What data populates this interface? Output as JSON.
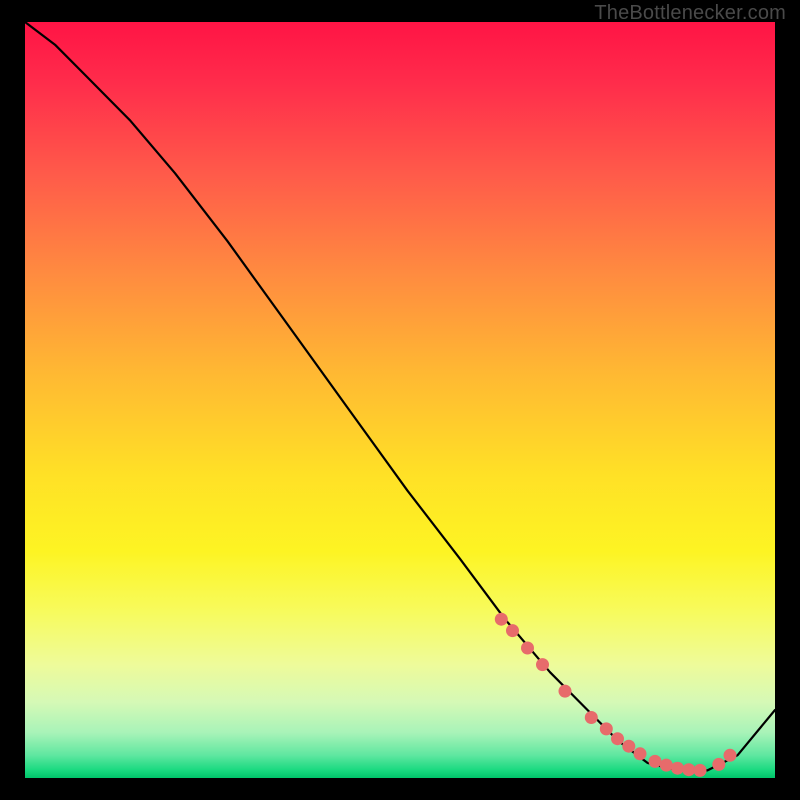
{
  "watermark": "TheBottlenecker.com",
  "chart_data": {
    "type": "line",
    "title": "",
    "xlabel": "",
    "ylabel": "",
    "xlim": [
      0,
      100
    ],
    "ylim": [
      0,
      100
    ],
    "curve": {
      "x": [
        0,
        4,
        8,
        14,
        20,
        27,
        35,
        43,
        51,
        58,
        64,
        70,
        75,
        79,
        83,
        87,
        91,
        95,
        100
      ],
      "y": [
        100,
        97,
        93,
        87,
        80,
        71,
        60,
        49,
        38,
        29,
        21,
        14,
        9,
        5,
        2,
        1,
        1,
        3,
        9
      ]
    },
    "markers": {
      "x": [
        63.5,
        65,
        67,
        69,
        72,
        75.5,
        77.5,
        79,
        80.5,
        82,
        84,
        85.5,
        87,
        88.5,
        90,
        92.5,
        94
      ],
      "y": [
        21,
        19.5,
        17.2,
        15,
        11.5,
        8,
        6.5,
        5.2,
        4.2,
        3.2,
        2.2,
        1.7,
        1.3,
        1.1,
        1,
        1.8,
        3
      ],
      "color": "#e76b6b",
      "radius": 6.5
    },
    "gradient_stops": [
      {
        "pos": 0.0,
        "color": "#ff1445"
      },
      {
        "pos": 0.2,
        "color": "#ff5a4a"
      },
      {
        "pos": 0.46,
        "color": "#ffb733"
      },
      {
        "pos": 0.7,
        "color": "#fdf423"
      },
      {
        "pos": 0.9,
        "color": "#d5f9b6"
      },
      {
        "pos": 1.0,
        "color": "#00c46a"
      }
    ]
  }
}
